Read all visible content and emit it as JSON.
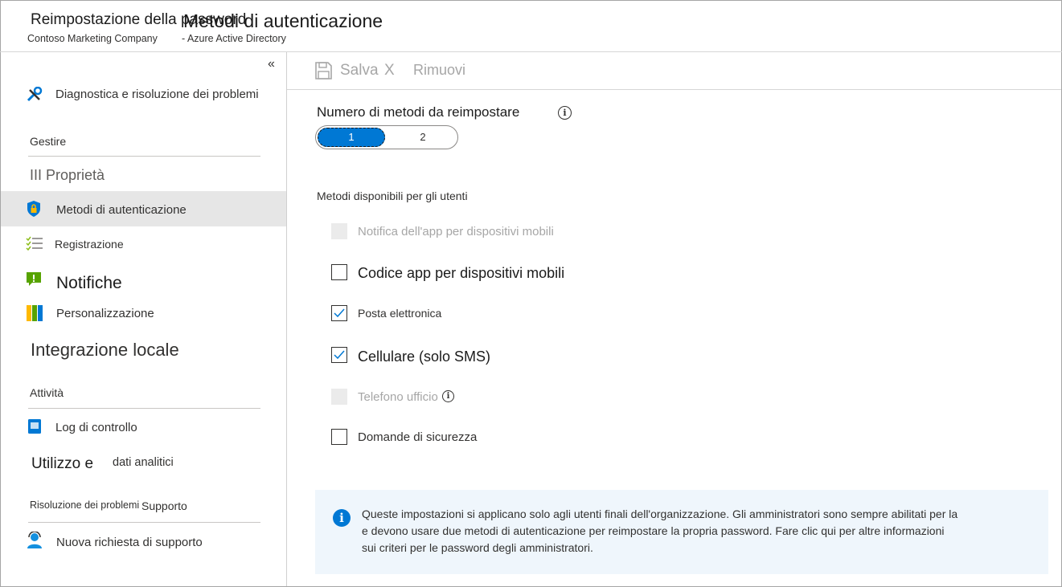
{
  "header": {
    "title": "Reimpostazione della password",
    "title_overlay": "Metodi di autenticazione",
    "org": "Contoso Marketing Company",
    "service": "- Azure Active Directory"
  },
  "sidebar": {
    "collapse_icon": "«",
    "troubleshoot": {
      "label": "Diagnostica e risoluzione dei problemi",
      "icon": "wrench-icon"
    },
    "manage_header": "Gestire",
    "items": [
      {
        "label": "III Proprietà"
      },
      {
        "label": "Metodi di autenticazione",
        "icon": "shield-lock-icon",
        "active": true
      },
      {
        "label": "Registrazione",
        "icon": "checklist-icon"
      },
      {
        "label": "Notifiche",
        "icon": "notification-icon"
      },
      {
        "label": "Personalizzazione",
        "icon": "customization-icon"
      }
    ],
    "onprem": "Integrazione locale",
    "activity_header": "Attività",
    "audit": {
      "label": "Log di controllo",
      "icon": "log-icon"
    },
    "usage_a": "Utilizzo e",
    "usage_b": "dati analitici",
    "support_header_a": "Risoluzione dei problemi",
    "support_header_b": "Supporto",
    "support": {
      "label": "Nuova richiesta di supporto",
      "icon": "support-person-icon"
    }
  },
  "toolbar": {
    "save": "Salva",
    "discard": "X",
    "remove": "Rimuovi"
  },
  "reset_count": {
    "label": "Numero di metodi da reimpostare",
    "options": [
      "1",
      "2"
    ],
    "selected": "1"
  },
  "methods": {
    "label": "Metodi disponibili per gli utenti",
    "items": [
      {
        "label": "Notifica dell'app per dispositivi mobili",
        "state": "disabled"
      },
      {
        "label": "Codice app per dispositivi mobili",
        "state": "unchecked"
      },
      {
        "label": "Posta elettronica",
        "state": "checked"
      },
      {
        "label": "Cellulare (solo SMS)",
        "state": "checked"
      },
      {
        "label": "Telefono ufficio",
        "state": "disabled"
      },
      {
        "label": "Domande di sicurezza",
        "state": "unchecked"
      }
    ]
  },
  "info": {
    "line1": "Queste impostazioni si applicano solo agli utenti finali dell'organizzazione. Gli amministratori sono sempre abilitati per la",
    "line2": "e devono usare due metodi di autenticazione per reimpostare la propria password. Fare clic qui per altre informazioni",
    "line3": "sui criteri per le password degli amministratori."
  },
  "colors": {
    "accent": "#0078d4",
    "active_bg": "#e6e6e6",
    "info_bg": "#eff6fc"
  }
}
